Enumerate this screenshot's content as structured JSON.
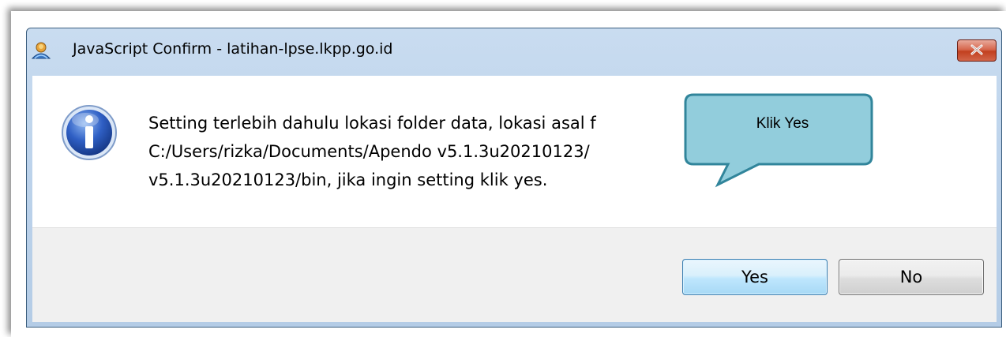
{
  "dialog": {
    "title": "JavaScript Confirm - latihan-lpse.lkpp.go.id",
    "message_lines": [
      "Setting terlebih dahulu lokasi folder data, lokasi asal f",
      "C:/Users/rizka/Documents/Apendo v5.1.3u20210123/",
      "v5.1.3u20210123/bin, jika ingin setting klik yes."
    ],
    "buttons": {
      "yes": "Yes",
      "no": "No"
    },
    "close_icon": "close-icon",
    "info_icon": "info-icon",
    "title_icon": "globe-user-icon"
  },
  "callout": {
    "text": "Klik Yes",
    "fill_color": "#92cddc",
    "border_color": "#31859b"
  },
  "colors": {
    "window_frame": "#bed4ec",
    "close_button": "#c2401f",
    "default_button_border": "#3c7fb1"
  }
}
